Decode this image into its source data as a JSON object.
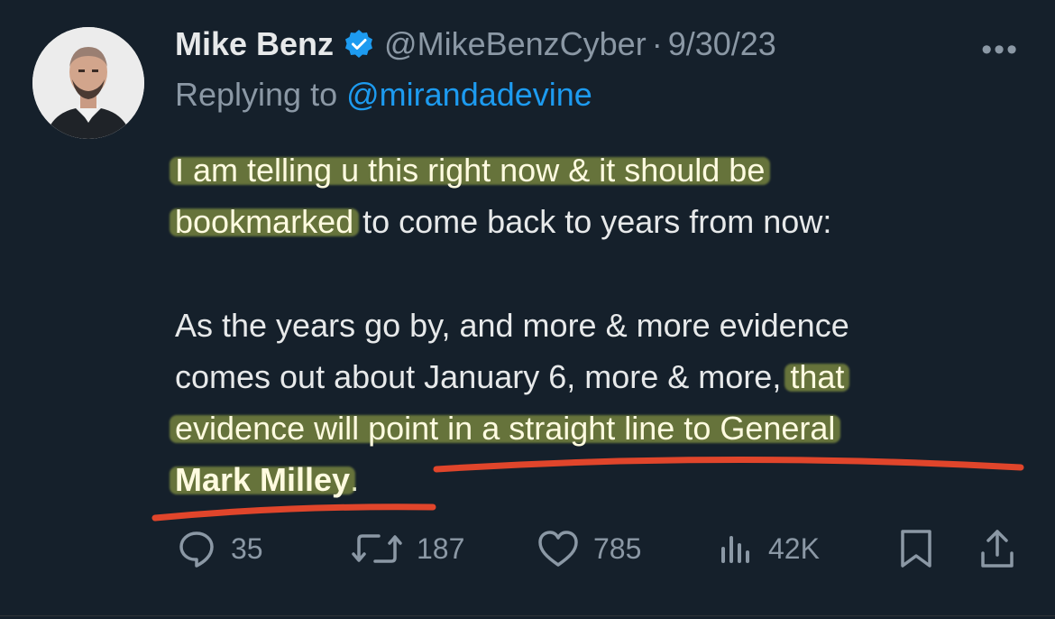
{
  "tweet": {
    "author_name": "Mike Benz",
    "handle": "@MikeBenzCyber",
    "separator": "·",
    "date": "9/30/23",
    "more": "•••",
    "reply_prefix": "Replying to",
    "reply_to": "@mirandadevine",
    "text": {
      "p1_l1": "I am telling u this right now & it should be",
      "p1_l2a": "bookmarked",
      "p1_l2b": " to come back to years from now:",
      "p2_l1": "As the years go by, and more & more evidence",
      "p2_l2a": "comes out about January 6, more & more, ",
      "p2_l2b": "that",
      "p2_l3": "evidence will point in a straight line to General",
      "p2_l4a": "Mark Milley",
      "p2_l4b": "."
    },
    "stats": {
      "replies": "35",
      "retweets": "187",
      "likes": "785",
      "views": "42K"
    }
  },
  "colors": {
    "background": "#15202b",
    "text": "#e7e9ea",
    "muted": "#8b98a5",
    "link": "#1d9bf0",
    "highlight": "#d6e650",
    "underline": "#e0452b"
  }
}
